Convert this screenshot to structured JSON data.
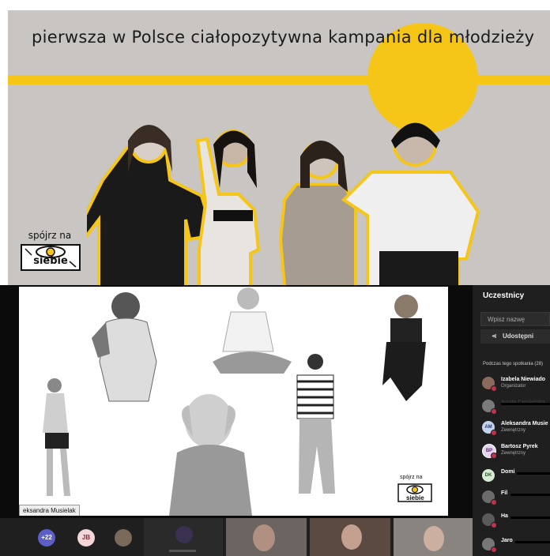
{
  "banner": {
    "title": "pierwsza w Polsce ciałopozytywna kampania dla młodzieży",
    "logo_top": "spójrz na",
    "logo_bottom": "siebie",
    "accent_color": "#f5c518"
  },
  "meeting": {
    "speaker_tag": "eksandra Musielak",
    "shared_logo_top": "spójrz na",
    "shared_logo_bottom": "siebie"
  },
  "participants_panel": {
    "title": "Uczestnicy",
    "search_placeholder": "Wpisz nazwę",
    "share_label": "Udostępni",
    "section_label": "Podczas tego spotkania (28)",
    "items": [
      {
        "initials": "",
        "name": "Izabela Niewiado",
        "role": "Organizator",
        "color": "#8a6a5a"
      },
      {
        "initials": "",
        "name": "Agata Ciesielska",
        "role": "",
        "color": "#7a7a7a"
      },
      {
        "initials": "AM",
        "name": "Aleksandra Musie",
        "role": "Zewnętrzny",
        "color": "#c5d3ee"
      },
      {
        "initials": "BP",
        "name": "Bartosz Pyrek",
        "role": "Zewnętrzny",
        "color": "#e6d3f0"
      },
      {
        "initials": "DK",
        "name": "Domi",
        "role": "",
        "color": "#d7ecd5"
      },
      {
        "initials": "",
        "name": "Fil",
        "role": "",
        "color": "#6b6b6b"
      },
      {
        "initials": "",
        "name": "Ha",
        "role": "",
        "color": "#5a5a5a"
      },
      {
        "initials": "",
        "name": "Jaro",
        "role": "",
        "color": "#777777"
      }
    ]
  },
  "bottom_bar": {
    "overflow_count": "+22",
    "jb_initials": "JB"
  },
  "colors": {
    "panel_bg": "#201f1f",
    "banner_bg": "#c9c5c2",
    "overflow_badge": "#5b5fc7",
    "jb_badge": "#f3d6d8"
  }
}
